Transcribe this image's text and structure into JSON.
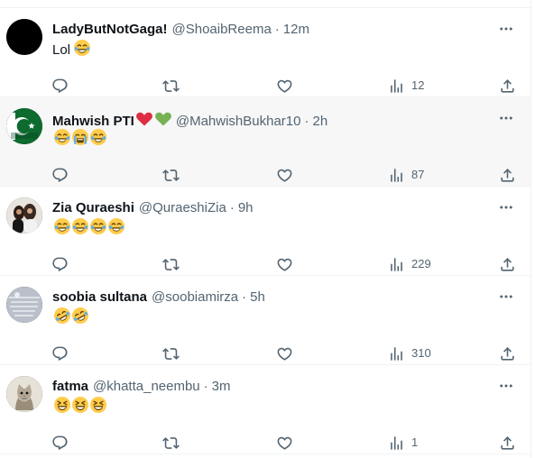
{
  "tweets": [
    {
      "display_name": "LadyButNotGaga!",
      "name_emojis": [],
      "handle": "@ShoaibReema",
      "separator": "·",
      "time": "12m",
      "text": "Lol",
      "emojis": [
        "face-with-tears-of-joy"
      ],
      "views": "12",
      "avatar": "black-circle"
    },
    {
      "display_name": "Mahwish PTI",
      "name_emojis": [
        "red-heart",
        "green-heart"
      ],
      "handle": "@MahwishBukhar10",
      "separator": "·",
      "time": "2h",
      "text": "",
      "emojis": [
        "face-with-tears-of-joy",
        "loudly-crying-face",
        "face-with-tears-of-joy"
      ],
      "views": "87",
      "avatar": "pakistan-flag"
    },
    {
      "display_name": "Zia Quraeshi",
      "name_emojis": [],
      "handle": "@QuraeshiZia",
      "separator": "·",
      "time": "9h",
      "text": "",
      "emojis": [
        "face-with-tears-of-joy",
        "face-with-tears-of-joy",
        "face-with-tears-of-joy",
        "face-with-tears-of-joy"
      ],
      "views": "229",
      "avatar": "people-photo"
    },
    {
      "display_name": "soobia sultana",
      "name_emojis": [],
      "handle": "@soobiamirza",
      "separator": "·",
      "time": "5h",
      "text": "",
      "emojis": [
        "rolling-on-floor-laughing",
        "rolling-on-floor-laughing"
      ],
      "views": "310",
      "avatar": "text-graphic"
    },
    {
      "display_name": "fatma",
      "name_emojis": [],
      "handle": "@khatta_neembu",
      "separator": "·",
      "time": "3m",
      "text": "",
      "emojis": [
        "grinning-squinting-face",
        "grinning-squinting-face",
        "grinning-squinting-face"
      ],
      "views": "1",
      "avatar": "cat-photo"
    }
  ],
  "icons": {
    "more": "more-horizontal-icon",
    "reply": "reply-icon",
    "retweet": "retweet-icon",
    "like": "like-icon",
    "views": "views-icon",
    "share": "share-icon"
  },
  "colors": {
    "text": "#0f1419",
    "secondary": "#536471",
    "hover_row": "#f7f7f7",
    "divider": "#eff3f4"
  }
}
